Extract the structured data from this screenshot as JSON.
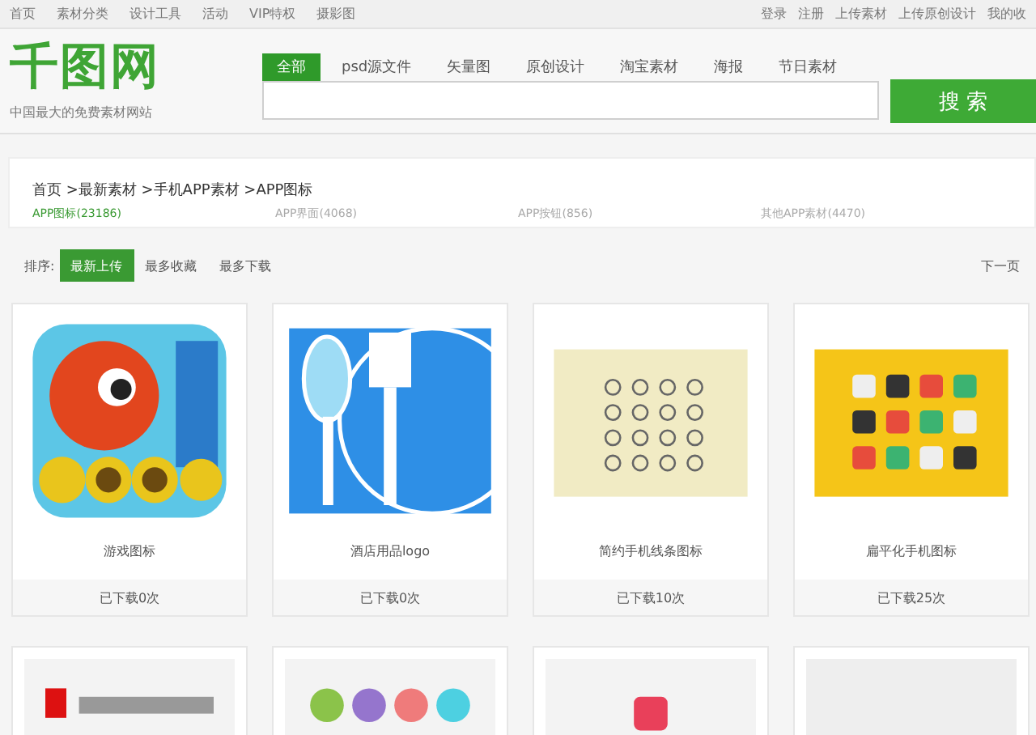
{
  "top_nav": {
    "left": [
      "首页",
      "素材分类",
      "设计工具",
      "活动",
      "VIP特权",
      "摄影图"
    ],
    "right": [
      "登录",
      "注册",
      "上传素材",
      "上传原创设计",
      "我的收"
    ]
  },
  "logo": {
    "text": "千图网",
    "tagline": "中国最大的免费素材网站"
  },
  "search": {
    "tabs": [
      {
        "label": "全部",
        "selected": true
      },
      {
        "label": "psd源文件",
        "selected": false
      },
      {
        "label": "矢量图",
        "selected": false
      },
      {
        "label": "原创设计",
        "selected": false
      },
      {
        "label": "淘宝素材",
        "selected": false
      },
      {
        "label": "海报",
        "selected": false
      },
      {
        "label": "节日素材",
        "selected": false
      }
    ],
    "button": "搜 索"
  },
  "breadcrumb": "首页 >最新素材 >手机APP素材 >APP图标",
  "categories": [
    {
      "label": "APP图标(23186)",
      "selected": true
    },
    {
      "label": "APP界面(4068)",
      "selected": false
    },
    {
      "label": "APP按钮(856)",
      "selected": false
    },
    {
      "label": "其他APP素材(4470)",
      "selected": false
    }
  ],
  "sort": {
    "label": "排序:",
    "options": [
      {
        "label": "最新上传",
        "selected": true
      },
      {
        "label": "最多收藏",
        "selected": false
      },
      {
        "label": "最多下载",
        "selected": false
      }
    ],
    "next": "下一页"
  },
  "cards": [
    {
      "title": "游戏图标",
      "downloads": "已下载0次"
    },
    {
      "title": "酒店用品logo",
      "downloads": "已下载0次"
    },
    {
      "title": "简约手机线条图标",
      "downloads": "已下载10次"
    },
    {
      "title": "扁平化手机图标",
      "downloads": "已下载25次"
    }
  ]
}
